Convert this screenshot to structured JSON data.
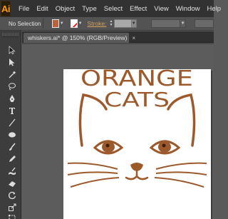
{
  "app": {
    "logo_text": "Ai"
  },
  "menu": {
    "items": [
      "File",
      "Edit",
      "Object",
      "Type",
      "Select",
      "Effect",
      "View",
      "Window",
      "Help"
    ]
  },
  "control_bar": {
    "selection_label": "No Selection",
    "fill_color": "#b7643e",
    "stroke_label": "Stroke:"
  },
  "document": {
    "tab_label": "whiskers.ai* @ 150% (RGB/Preview)",
    "close_glyph": "×"
  },
  "artwork": {
    "line1": "ORANGE",
    "line2": "CATS",
    "color": "#9c5a2c"
  },
  "tools": [
    "selection-tool",
    "direct-selection-tool",
    "magic-wand-tool",
    "lasso-tool",
    "pen-tool",
    "type-tool",
    "line-segment-tool",
    "ellipse-tool",
    "paintbrush-tool",
    "pencil-tool",
    "blob-brush-tool",
    "eraser-tool",
    "rotate-tool",
    "scale-tool",
    "warp-tool",
    "free-transform-tool"
  ]
}
